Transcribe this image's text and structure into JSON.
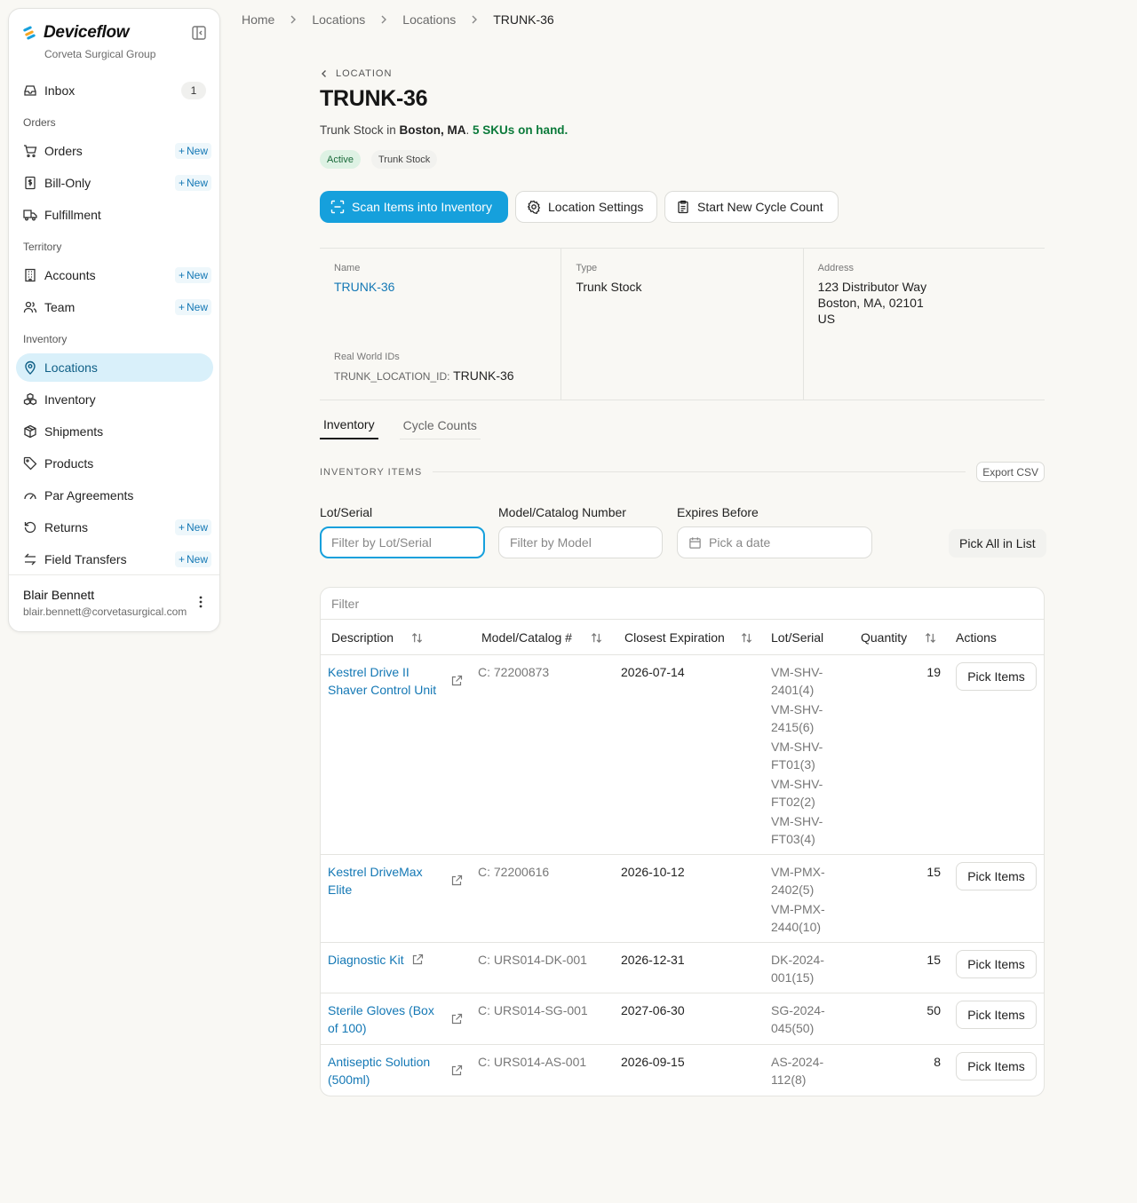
{
  "brand": {
    "name": "Deviceflow",
    "org": "Corveta Surgical Group"
  },
  "sidebar": {
    "inbox": {
      "label": "Inbox",
      "count": "1"
    },
    "sections": {
      "orders": "Orders",
      "territory": "Territory",
      "inventory": "Inventory"
    },
    "new_label": "New",
    "items": {
      "orders": "Orders",
      "bill_only": "Bill-Only",
      "fulfillment": "Fulfillment",
      "accounts": "Accounts",
      "team": "Team",
      "locations": "Locations",
      "inventory": "Inventory",
      "shipments": "Shipments",
      "products": "Products",
      "par_agreements": "Par Agreements",
      "returns": "Returns",
      "field_transfers": "Field Transfers"
    },
    "user": {
      "name": "Blair Bennett",
      "email": "blair.bennett@corvetasurgical.com"
    }
  },
  "breadcrumb": [
    "Home",
    "Locations",
    "Locations",
    "TRUNK-36"
  ],
  "header": {
    "back_label": "LOCATION",
    "title": "TRUNK-36",
    "summary_prefix": "Trunk Stock in ",
    "summary_city": "Boston, MA",
    "summary_dot": ". ",
    "summary_sku": "5 SKUs on hand.",
    "tags": {
      "status": "Active",
      "type": "Trunk Stock"
    }
  },
  "actions": {
    "scan": "Scan Items into Inventory",
    "settings": "Location Settings",
    "cycle": "Start New Cycle Count"
  },
  "details": {
    "name_label": "Name",
    "name_value": "TRUNK-36",
    "type_label": "Type",
    "type_value": "Trunk Stock",
    "address_label": "Address",
    "address_line1": "123 Distributor Way",
    "address_line2": "Boston, MA, 02101",
    "address_line3": "US",
    "rwi_label": "Real World IDs",
    "rwi_key": "TRUNK_LOCATION_ID:",
    "rwi_value": "TRUNK-36"
  },
  "tabs": [
    "Inventory",
    "Cycle Counts"
  ],
  "inventory_section": {
    "title": "INVENTORY ITEMS",
    "export": "Export CSV"
  },
  "filters": {
    "lot_label": "Lot/Serial",
    "lot_placeholder": "Filter by Lot/Serial",
    "model_label": "Model/Catalog Number",
    "model_placeholder": "Filter by Model",
    "expires_label": "Expires Before",
    "expires_placeholder": "Pick a date",
    "pick_all": "Pick All in List"
  },
  "table": {
    "filter_placeholder": "Filter",
    "columns": [
      "Description",
      "Model/Catalog #",
      "Closest Expiration",
      "Lot/Serial",
      "Quantity",
      "Actions"
    ],
    "pick_label": "Pick Items",
    "rows": [
      {
        "desc": "Kestrel Drive II Shaver Control Unit",
        "model": "C: 72200873",
        "exp": "2026-07-14",
        "lots": [
          "VM-SHV-2401(4)",
          "VM-SHV-2415(6)",
          "VM-SHV-FT01(3)",
          "VM-SHV-FT02(2)",
          "VM-SHV-FT03(4)"
        ],
        "qty": "19"
      },
      {
        "desc": "Kestrel DriveMax Elite",
        "model": "C: 72200616",
        "exp": "2026-10-12",
        "lots": [
          "VM-PMX-2402(5)",
          "VM-PMX-2440(10)"
        ],
        "qty": "15"
      },
      {
        "desc": "Diagnostic Kit",
        "model": "C: URS014-DK-001",
        "exp": "2026-12-31",
        "lots": [
          "DK-2024-001(15)"
        ],
        "qty": "15"
      },
      {
        "desc": "Sterile Gloves (Box of 100)",
        "model": "C: URS014-SG-001",
        "exp": "2027-06-30",
        "lots": [
          "SG-2024-045(50)"
        ],
        "qty": "50"
      },
      {
        "desc": "Antiseptic Solution (500ml)",
        "model": "C: URS014-AS-001",
        "exp": "2026-09-15",
        "lots": [
          "AS-2024-112(8)"
        ],
        "qty": "8"
      }
    ]
  },
  "colors": {
    "accent": "#16a0dc",
    "link": "#1478b5",
    "success": "#0b7a3a",
    "active_nav": "#d9f0fa"
  }
}
